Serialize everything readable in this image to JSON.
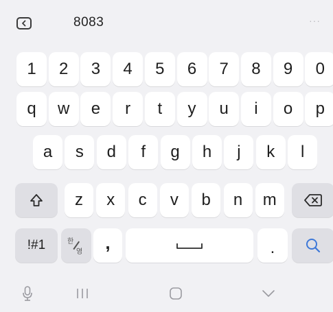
{
  "toolbar": {
    "back_icon": "collapse-left-icon",
    "suggestion": "8083",
    "more_label": "···"
  },
  "rows": {
    "numbers": [
      "1",
      "2",
      "3",
      "4",
      "5",
      "6",
      "7",
      "8",
      "9",
      "0"
    ],
    "top": [
      "q",
      "w",
      "e",
      "r",
      "t",
      "y",
      "u",
      "i",
      "o",
      "p"
    ],
    "middle": [
      "a",
      "s",
      "d",
      "f",
      "g",
      "h",
      "j",
      "k",
      "l"
    ],
    "bottom": [
      "z",
      "x",
      "c",
      "v",
      "b",
      "n",
      "m"
    ]
  },
  "function_keys": {
    "shift_icon": "shift-icon",
    "backspace_icon": "backspace-icon",
    "symbols_label": "!#1",
    "lang_top": "한",
    "lang_bottom": "영",
    "comma_label": ",",
    "space_icon": "space-bar-icon",
    "period_label": ".",
    "search_icon": "search-icon",
    "accent_color": "#3d78d8"
  },
  "navbar": {
    "mic_icon": "microphone-icon",
    "recents_icon": "recent-apps-icon",
    "home_icon": "home-icon",
    "hide_icon": "chevron-down-icon"
  }
}
